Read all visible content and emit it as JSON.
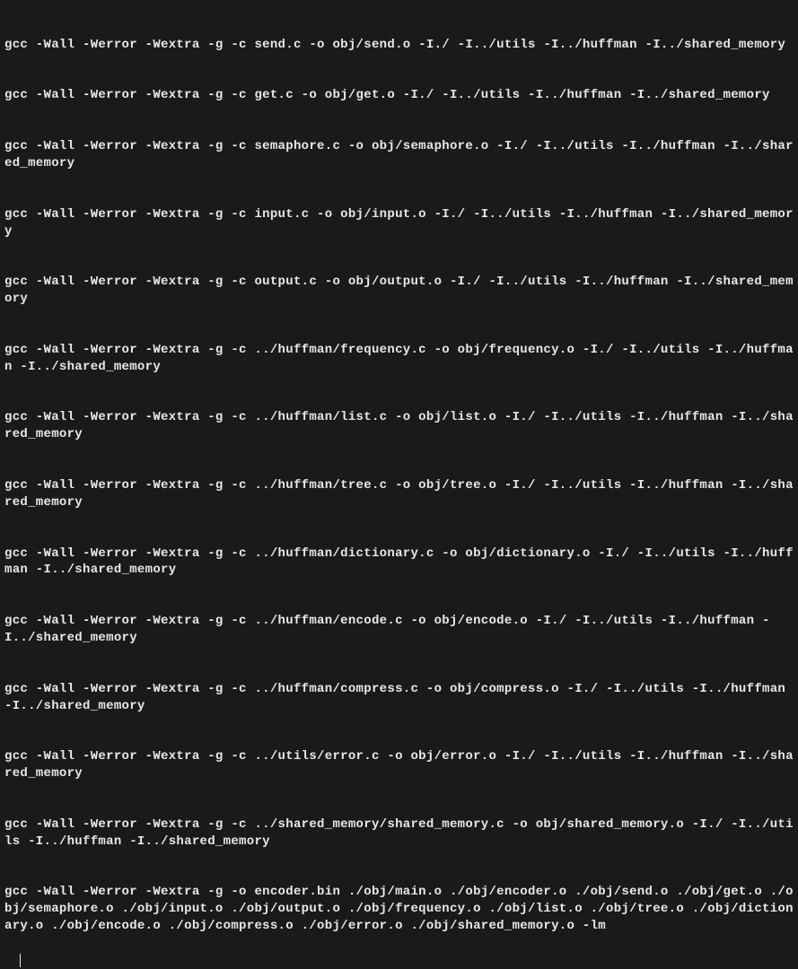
{
  "terminal": {
    "lines": [
      "gcc -Wall -Werror -Wextra -g -c send.c -o obj/send.o -I./ -I../utils -I../huffman -I../shared_memory",
      "gcc -Wall -Werror -Wextra -g -c get.c -o obj/get.o -I./ -I../utils -I../huffman -I../shared_memory",
      "gcc -Wall -Werror -Wextra -g -c semaphore.c -o obj/semaphore.o -I./ -I../utils -I../huffman -I../shared_memory",
      "gcc -Wall -Werror -Wextra -g -c input.c -o obj/input.o -I./ -I../utils -I../huffman -I../shared_memory",
      "gcc -Wall -Werror -Wextra -g -c output.c -o obj/output.o -I./ -I../utils -I../huffman -I../shared_memory",
      "gcc -Wall -Werror -Wextra -g -c ../huffman/frequency.c -o obj/frequency.o -I./ -I../utils -I../huffman -I../shared_memory",
      "gcc -Wall -Werror -Wextra -g -c ../huffman/list.c -o obj/list.o -I./ -I../utils -I../huffman -I../shared_memory",
      "gcc -Wall -Werror -Wextra -g -c ../huffman/tree.c -o obj/tree.o -I./ -I../utils -I../huffman -I../shared_memory",
      "gcc -Wall -Werror -Wextra -g -c ../huffman/dictionary.c -o obj/dictionary.o -I./ -I../utils -I../huffman -I../shared_memory",
      "gcc -Wall -Werror -Wextra -g -c ../huffman/encode.c -o obj/encode.o -I./ -I../utils -I../huffman -I../shared_memory",
      "gcc -Wall -Werror -Wextra -g -c ../huffman/compress.c -o obj/compress.o -I./ -I../utils -I../huffman -I../shared_memory",
      "gcc -Wall -Werror -Wextra -g -c ../utils/error.c -o obj/error.o -I./ -I../utils -I../huffman -I../shared_memory",
      "gcc -Wall -Werror -Wextra -g -c ../shared_memory/shared_memory.c -o obj/shared_memory.o -I./ -I../utils -I../huffman -I../shared_memory",
      "gcc -Wall -Werror -Wextra -g -o encoder.bin ./obj/main.o ./obj/encoder.o ./obj/send.o ./obj/get.o ./obj/semaphore.o ./obj/input.o ./obj/output.o ./obj/frequency.o ./obj/list.o ./obj/tree.o ./obj/dictionary.o ./obj/encode.o ./obj/compress.o ./obj/error.o ./obj/shared_memory.o -lm"
    ]
  }
}
